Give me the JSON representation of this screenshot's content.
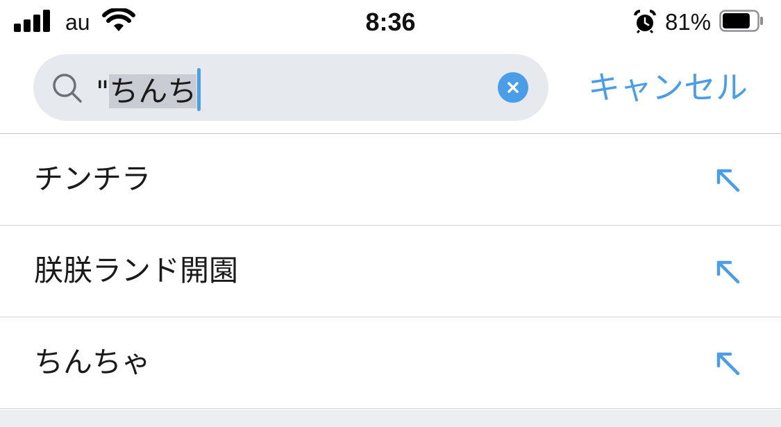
{
  "status_bar": {
    "carrier": "au",
    "time": "8:36",
    "battery_percent": "81%",
    "battery_level": 0.81
  },
  "search": {
    "query_prefix": "\"",
    "query_selected": "ちんち",
    "cancel_label": "キャンセル",
    "accent_color": "#4a9ee8"
  },
  "suggestions": [
    {
      "label": "チンチラ",
      "icon": "arrow-up-left-icon"
    },
    {
      "label": "朕朕ランド開園",
      "icon": "arrow-up-left-icon"
    },
    {
      "label": "ちんちゃ",
      "icon": "arrow-up-left-icon"
    }
  ]
}
